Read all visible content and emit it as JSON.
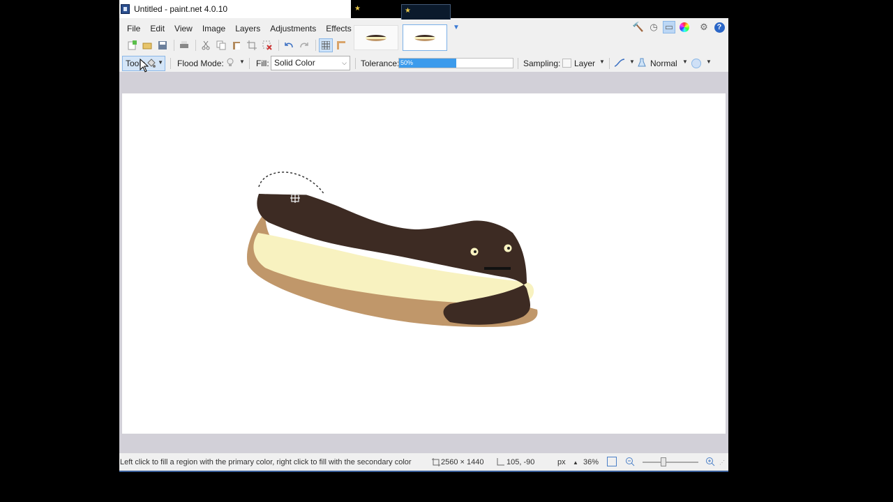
{
  "window": {
    "title": "Untitled - paint.net 4.0.10"
  },
  "menu": [
    "File",
    "Edit",
    "View",
    "Image",
    "Layers",
    "Adjustments",
    "Effects"
  ],
  "toolbar_icons": [
    "new-icon",
    "open-icon",
    "save-icon",
    "print-icon",
    "cut-icon",
    "copy-icon",
    "paste-icon",
    "crop-icon",
    "deselect-icon",
    "undo-icon",
    "redo-icon",
    "grid-icon",
    "ruler-icon"
  ],
  "options": {
    "tools_label": "Tools",
    "flood_mode_label": "Flood Mode:",
    "fill_label": "Fill:",
    "fill_value": "Solid Color",
    "tolerance_label": "Tolerance:",
    "tolerance_value": "50%",
    "tolerance_fraction": 0.5,
    "sampling_label": "Sampling:",
    "sampling_value": "Layer",
    "blend_mode": "Normal"
  },
  "status": {
    "hint": "Left click to fill a region with the primary color, right click to fill with the secondary color",
    "image_size": "2560 × 1440",
    "cursor_pos": "105, -90",
    "units": "px",
    "zoom": "36%"
  },
  "colors": {
    "chocolate": "#3d2b23",
    "cream": "#f8f2c0",
    "pastry": "#c0976a",
    "accent": "#3c9bec"
  }
}
